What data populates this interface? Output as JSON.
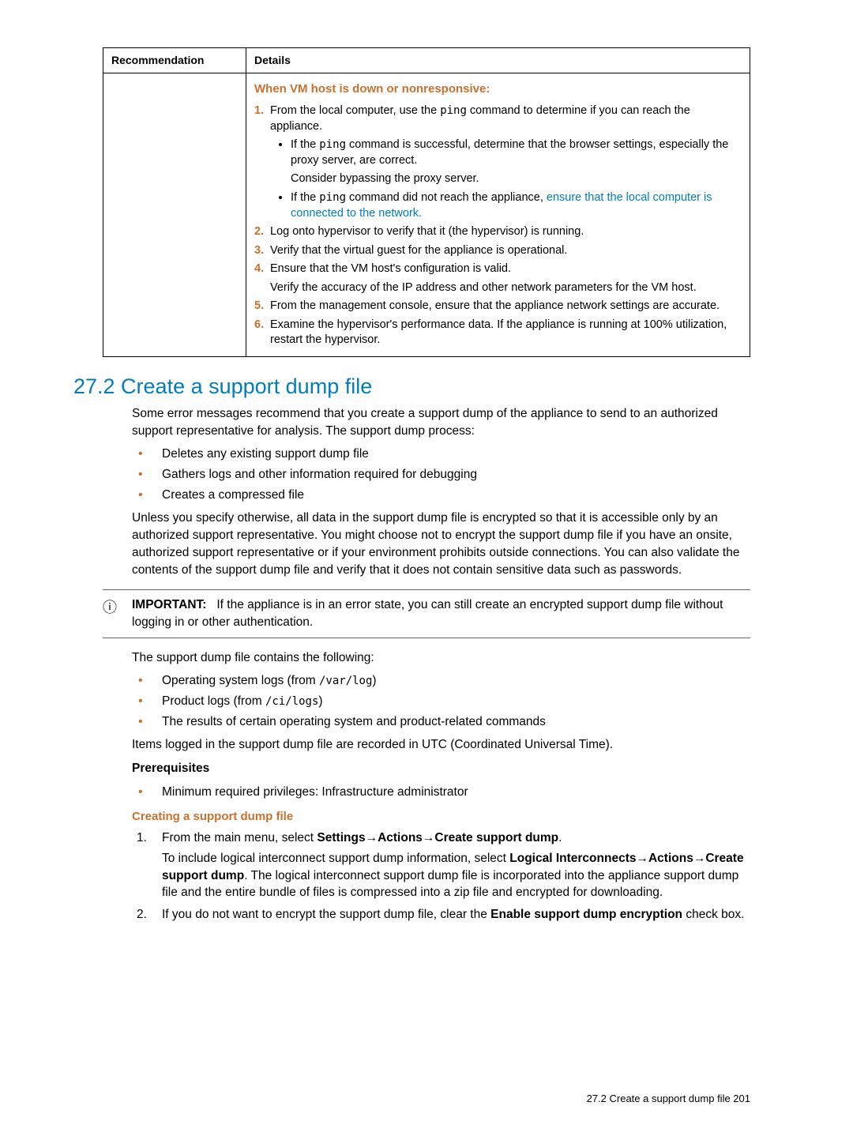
{
  "table": {
    "header_rec": "Recommendation",
    "header_det": "Details",
    "subhead": "When VM host is down or nonresponsive:",
    "steps": {
      "s1a": "From the local computer, use the ",
      "s1b": " command to determine if you can reach the appliance.",
      "ping": "ping",
      "s1_sub1a": "If the ",
      "s1_sub1b": " command is successful, determine that the browser settings, especially the proxy server, are correct.",
      "s1_sub1c": "Consider bypassing the proxy server.",
      "s1_sub2a": "If the ",
      "s1_sub2b": " command did not reach the appliance, ",
      "s1_sub2_link": "ensure that the local computer is connected to the network.",
      "s2": "Log onto hypervisor to verify that it (the hypervisor) is running.",
      "s3": "Verify that the virtual guest for the appliance is operational.",
      "s4a": "Ensure that the VM host's configuration is valid.",
      "s4b": "Verify the accuracy of the IP address and other network parameters for the VM host.",
      "s5": "From the management console, ensure that the appliance network settings are accurate.",
      "s6": "Examine the hypervisor's performance data. If the appliance is running at 100% utilization, restart the hypervisor."
    }
  },
  "section": {
    "heading": "27.2 Create a support dump file",
    "intro": "Some error messages recommend that you create a support dump of the appliance to send to an authorized support representative for analysis. The support dump process:",
    "bullets1": [
      "Deletes any existing support dump file",
      "Gathers logs and other information required for debugging",
      "Creates a compressed file"
    ],
    "para2": "Unless you specify otherwise, all data in the support dump file is encrypted so that it is accessible only by an authorized support representative. You might choose not to encrypt the support dump file if you have an onsite, authorized support representative or if your environment prohibits outside connections. You can also validate the contents of the support dump file and verify that it does not contain sensitive data such as passwords.",
    "important_label": "IMPORTANT:",
    "important_text": "If the appliance is in an error state, you can still create an encrypted support dump file without logging in or other authentication.",
    "para3": "The support dump file contains the following:",
    "b2_1a": "Operating system logs (from ",
    "b2_1b": ")",
    "path1": "/var/log",
    "b2_2a": "Product logs (from ",
    "b2_2b": ")",
    "path2": "/ci/logs",
    "b2_3": "The results of certain operating system and product-related commands",
    "para4": "Items logged in the support dump file are recorded in UTC (Coordinated Universal Time).",
    "prereq_label": "Prerequisites",
    "prereq_item": "Minimum required privileges: Infrastructure administrator",
    "proc_heading": "Creating a support dump file",
    "step1a": "From the main menu, select ",
    "step1_nav": "Settings→Actions→Create support dump",
    "step1_period": ".",
    "step1_p2a": "To include logical interconnect support dump information, select ",
    "step1_nav2": "Logical Interconnects→Actions→Create support dump",
    "step1_p2b": ". The logical interconnect support dump file is incorporated into the appliance support dump file and the entire bundle of files is compressed into a zip file and encrypted for downloading.",
    "step2a": "If you do not want to encrypt the support dump file, clear the ",
    "step2_bold": "Enable support dump encryption",
    "step2b": " check box."
  },
  "footer": "27.2 Create a support dump file   201"
}
